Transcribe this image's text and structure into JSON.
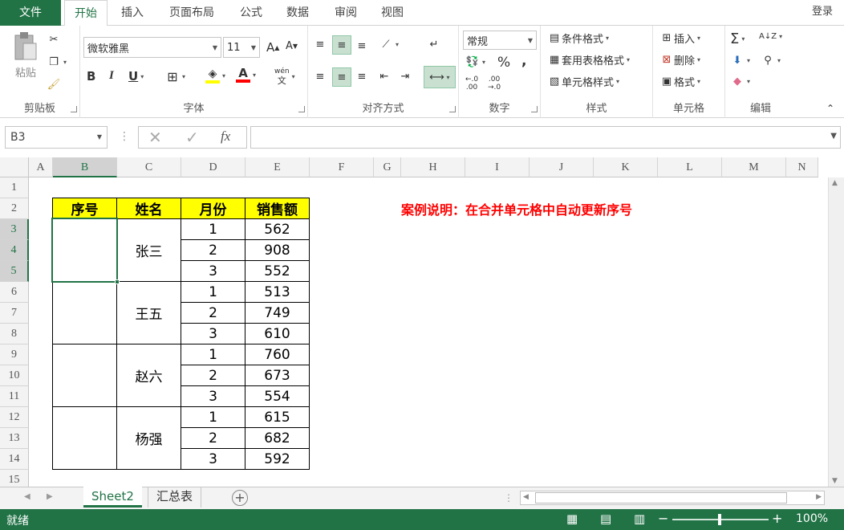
{
  "tabs": {
    "file": "文件",
    "home": "开始",
    "insert": "插入",
    "page_layout": "页面布局",
    "formulas": "公式",
    "data": "数据",
    "review": "审阅",
    "view": "视图",
    "login": "登录"
  },
  "ribbon": {
    "clipboard": {
      "paste": "粘贴",
      "label": "剪贴板"
    },
    "font": {
      "name": "微软雅黑",
      "size": "11",
      "bold": "B",
      "italic": "I",
      "underline": "U",
      "grow": "A",
      "shrink": "A",
      "font_color_glyph": "A",
      "phonetic_top": "wén",
      "phonetic_bottom": "文",
      "label": "字体"
    },
    "alignment": {
      "label": "对齐方式"
    },
    "number": {
      "format": "常规",
      "percent": "%",
      "comma": ",",
      "inc_decimal_top": "←.0",
      "inc_decimal_bottom": ".00",
      "dec_decimal_top": ".00",
      "dec_decimal_bottom": "→.0",
      "label": "数字"
    },
    "styles": {
      "conditional": "条件格式",
      "table_format": "套用表格格式",
      "cell_styles": "单元格样式",
      "label": "样式"
    },
    "cells": {
      "insert": "插入",
      "delete": "删除",
      "format": "格式",
      "label": "单元格"
    },
    "editing": {
      "sum": "Σ",
      "sort": "A↓Z",
      "label": "编辑"
    }
  },
  "formula_bar": {
    "name_box": "B3",
    "fx": "fx",
    "formula": ""
  },
  "grid": {
    "columns": [
      "A",
      "B",
      "C",
      "D",
      "E",
      "F",
      "G",
      "H",
      "I",
      "J",
      "K",
      "L",
      "M",
      "N"
    ],
    "rows": [
      "1",
      "2",
      "3",
      "4",
      "5",
      "6",
      "7",
      "8",
      "9",
      "10",
      "11",
      "12",
      "13",
      "14",
      "15"
    ],
    "selected_cell": "B3",
    "table_headers": [
      "序号",
      "姓名",
      "月份",
      "销售额"
    ],
    "groups": [
      {
        "name": "张三",
        "months": [
          "1",
          "2",
          "3"
        ],
        "sales": [
          "562",
          "908",
          "552"
        ]
      },
      {
        "name": "王五",
        "months": [
          "1",
          "2",
          "3"
        ],
        "sales": [
          "513",
          "749",
          "610"
        ]
      },
      {
        "name": "赵六",
        "months": [
          "1",
          "2",
          "3"
        ],
        "sales": [
          "760",
          "673",
          "554"
        ]
      },
      {
        "name": "杨强",
        "months": [
          "1",
          "2",
          "3"
        ],
        "sales": [
          "615",
          "682",
          "592"
        ]
      }
    ],
    "note": "案例说明：在合并单元格中自动更新序号"
  },
  "sheets": {
    "items": [
      "Sheet2",
      "汇总表"
    ],
    "active": "Sheet2",
    "add": "+"
  },
  "status": {
    "ready": "就绪",
    "zoom": "100%"
  },
  "colors": {
    "accent": "#217346",
    "header_fill": "#ffff00",
    "note": "#ff0000",
    "font_color_underline": "#ff0000",
    "fill_color_underline": "#ffff00"
  }
}
